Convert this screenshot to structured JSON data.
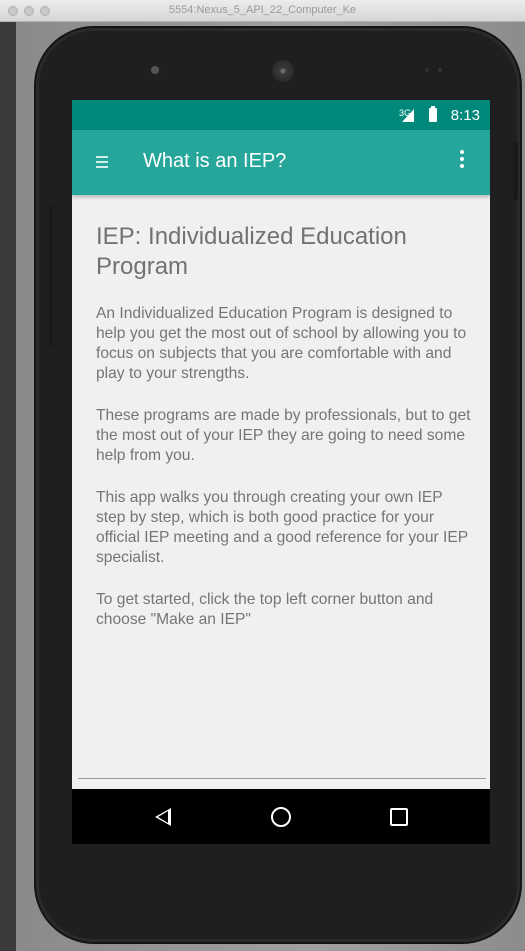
{
  "window": {
    "title": "5554:Nexus_5_API_22_Computer_Ke"
  },
  "status_bar": {
    "network": "3G",
    "time": "8:13"
  },
  "app_bar": {
    "title": "What is an IEP?",
    "menu_icon": "hamburger-menu-icon",
    "overflow_icon": "more-vert-icon",
    "color": "#26a69a"
  },
  "status_bar_color": "#00897b",
  "content": {
    "heading": "IEP: Individualized Education Program",
    "paragraphs": [
      "An Individualized Education Program is designed to help you get the most out of school by allowing you to focus on subjects that you are comfortable with and play to your strengths.",
      "These programs are made by professionals, but to get the most out of your IEP they are going to need some help from you.",
      "This app walks you through creating your own IEP step by step, which is both good practice for your official IEP meeting and a good reference for your IEP specialist.",
      "To get started, click the top left corner button and choose \"Make an IEP\""
    ]
  },
  "nav_bar": {
    "back_icon": "back-triangle-icon",
    "home_icon": "home-circle-icon",
    "recents_icon": "recents-square-icon"
  }
}
